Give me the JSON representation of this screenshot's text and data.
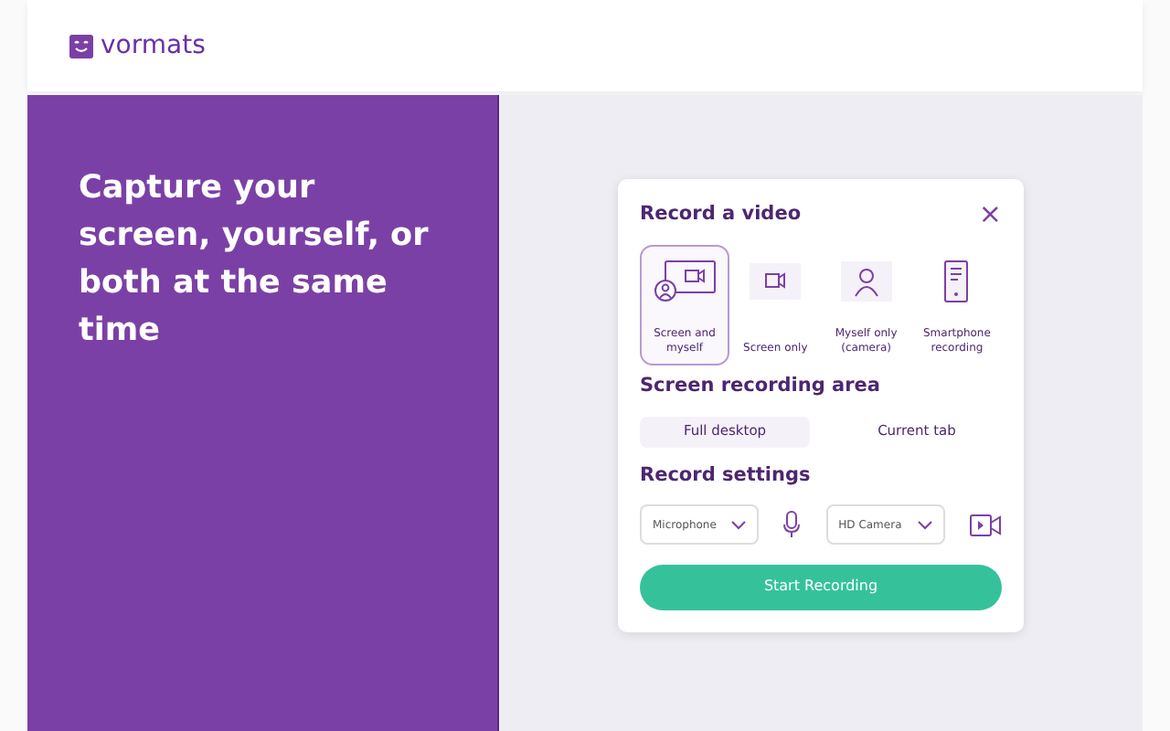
{
  "brand": {
    "name": "vormats"
  },
  "hero": {
    "headline": "Capture your screen, yourself, or both at the same time"
  },
  "dialog": {
    "title": "Record a video",
    "close": "×",
    "modes": [
      {
        "kind": "screen-camera",
        "label": "Screen and myself",
        "selected": true
      },
      {
        "kind": "camera",
        "label": "Screen only",
        "selected": false
      },
      {
        "kind": "person",
        "label": "Myself only (camera)",
        "selected": false
      },
      {
        "kind": "phone",
        "label": "Smartphone recording",
        "selected": false
      }
    ],
    "area_heading": "Screen recording area",
    "areas": [
      {
        "label": "Full desktop",
        "selected": true
      },
      {
        "label": "Current tab",
        "selected": false
      }
    ],
    "settings_heading": "Record settings",
    "microphone": {
      "value": "Microphone"
    },
    "camera": {
      "value": "HD Camera"
    },
    "start_button": "Start Recording"
  }
}
